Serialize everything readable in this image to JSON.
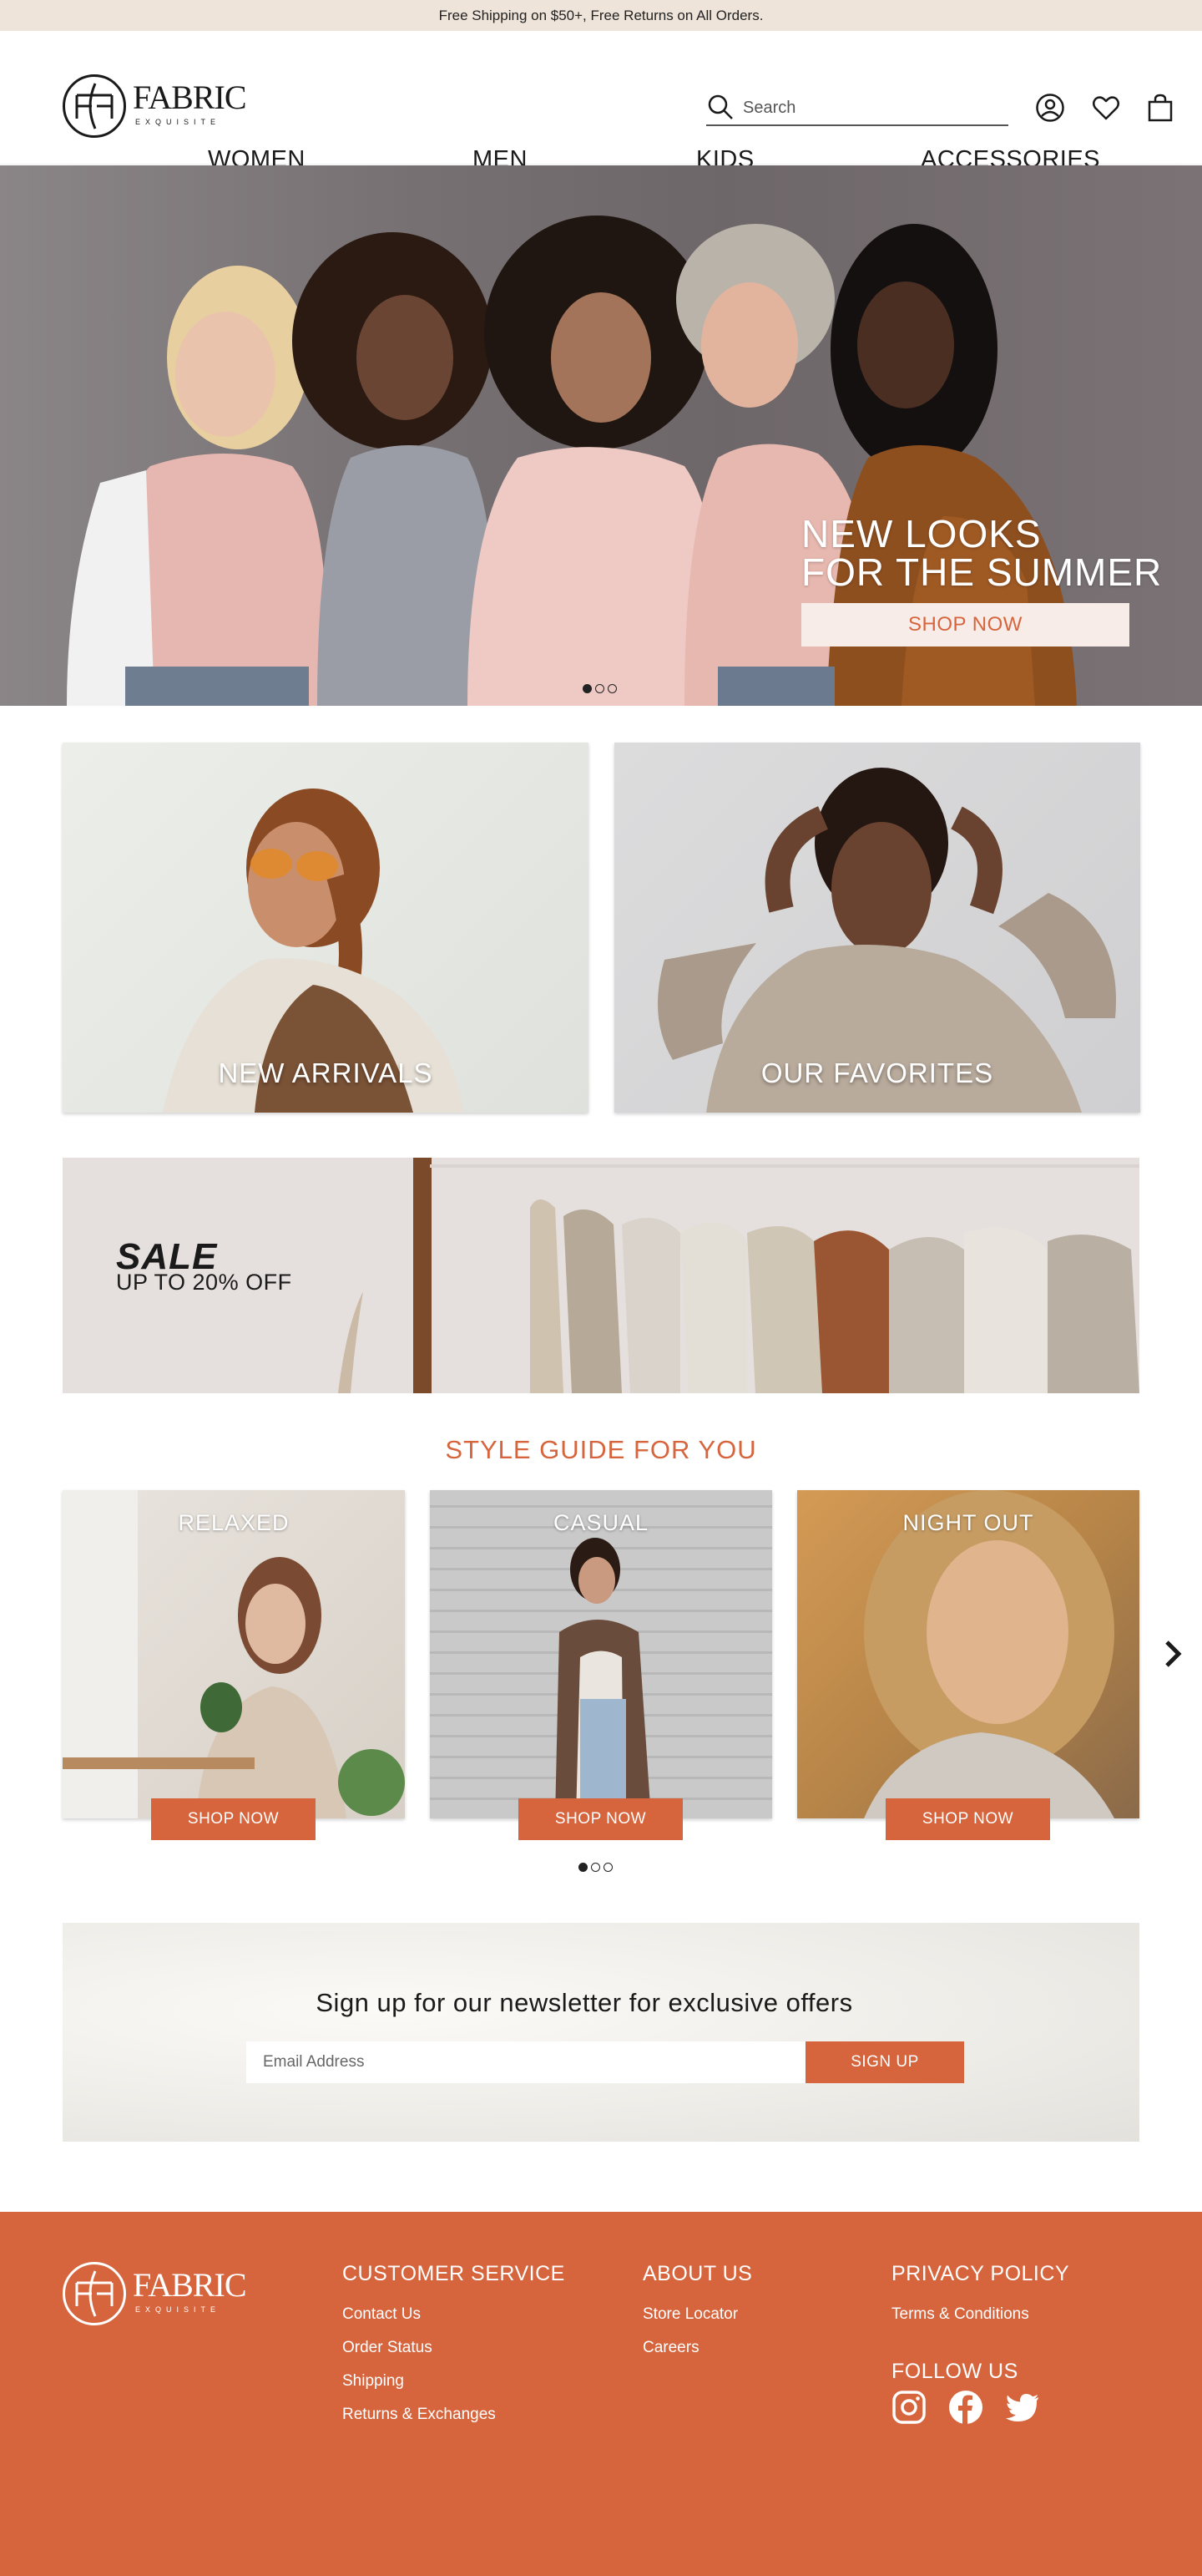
{
  "promo": {
    "text": "Free Shipping on $50+, Free Returns on All Orders."
  },
  "brand": {
    "name": "FABRIC",
    "tagline": "EXQUISITE"
  },
  "search": {
    "placeholder": "Search"
  },
  "header_icons": [
    "account-icon",
    "heart-icon",
    "shopping-bag-icon"
  ],
  "nav": {
    "items": [
      "WOMEN",
      "MEN",
      "KIDS",
      "ACCESSORIES"
    ]
  },
  "hero": {
    "title_line1": "NEW LOOKS",
    "title_line2": "FOR THE SUMMER",
    "button": "SHOP NOW",
    "slides": 3,
    "active_slide": 1
  },
  "categories": [
    {
      "label": "NEW ARRIVALS"
    },
    {
      "label": "OUR FAVORITES"
    }
  ],
  "sale": {
    "title": "SALE",
    "subtitle": "UP TO 20% OFF"
  },
  "style_guide": {
    "title": "STYLE GUIDE FOR YOU",
    "cards": [
      {
        "label": "RELAXED",
        "button": "SHOP NOW"
      },
      {
        "label": "CASUAL",
        "button": "SHOP NOW"
      },
      {
        "label": "NIGHT OUT",
        "button": "SHOP NOW"
      }
    ],
    "pages": 3,
    "active_page": 1
  },
  "newsletter": {
    "title": "Sign up for our newsletter for exclusive offers",
    "placeholder": "Email Address",
    "button": "SIGN UP"
  },
  "footer": {
    "customer_service": {
      "heading": "CUSTOMER SERVICE",
      "links": [
        "Contact Us",
        "Order Status",
        "Shipping",
        "Returns & Exchanges"
      ]
    },
    "about": {
      "heading": "ABOUT US",
      "links": [
        "Store Locator",
        "Careers"
      ]
    },
    "privacy": {
      "heading": "PRIVACY POLICY",
      "links": [
        "Terms & Conditions"
      ]
    },
    "follow": {
      "heading": "FOLLOW US",
      "icons": [
        "instagram-icon",
        "facebook-icon",
        "twitter-icon"
      ]
    }
  },
  "colors": {
    "accent": "#d6653d",
    "promo_bg": "#efe4d9",
    "hero_button_bg": "#f7ece7"
  }
}
